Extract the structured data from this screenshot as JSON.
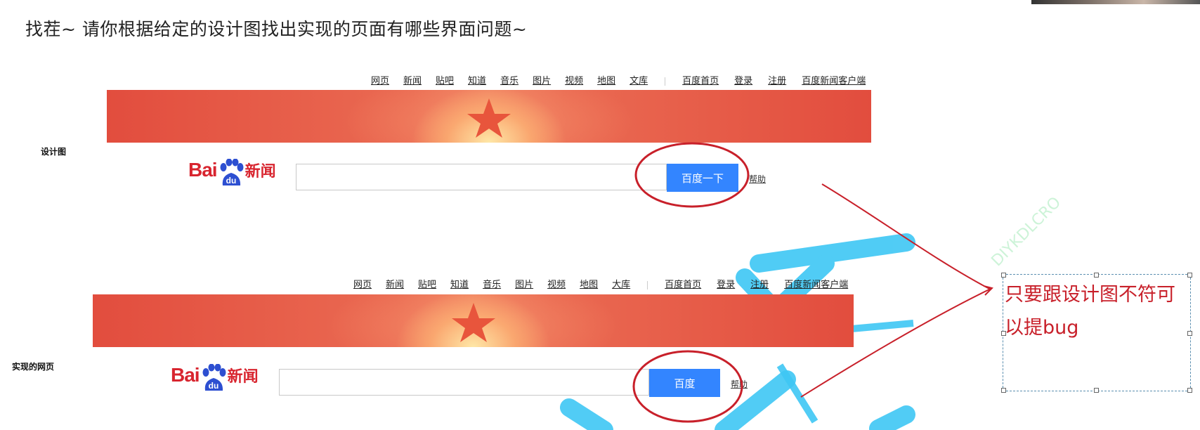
{
  "header": {
    "title": "找茬~ 请你根据给定的设计图找出实现的页面有哪些界面问题~"
  },
  "design": {
    "label": "设计图",
    "nav_left": [
      "网页",
      "新闻",
      "贴吧",
      "知道",
      "音乐",
      "图片",
      "视频",
      "地图",
      "文库"
    ],
    "nav_right": [
      "百度首页",
      "登录",
      "注册",
      "百度新闻客户端"
    ],
    "logo_text": "Bai",
    "logo_paw": "du",
    "logo_news": "新闻",
    "button_label": "百度一下",
    "help_label": "帮助"
  },
  "implementation": {
    "label": "实现的网页",
    "nav_left": [
      "网页",
      "新闻",
      "贴吧",
      "知道",
      "音乐",
      "图片",
      "视频",
      "地图",
      "大库"
    ],
    "nav_right": [
      "百度首页",
      "登录",
      "注册",
      "百度新闻客户端"
    ],
    "logo_text": "Bai",
    "logo_paw": "du",
    "logo_news": "新闻",
    "button_label": "百度",
    "help_label": "帮助"
  },
  "note": {
    "text": "只要跟设计图不符可以提bug"
  },
  "colors": {
    "baidu_red": "#d8252f",
    "button_blue": "#3385ff",
    "annotation_red": "#c8202a",
    "watermark_cyan": "#3ec7f4"
  },
  "watermark_text": "DIYKDLCRO"
}
